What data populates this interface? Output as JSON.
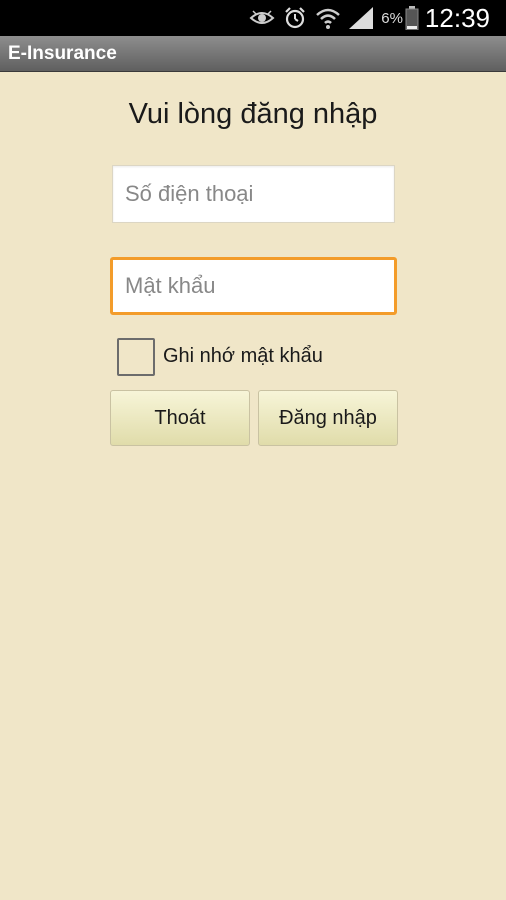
{
  "status_bar": {
    "battery_percent": "6%",
    "time": "12:39",
    "icons": [
      "eye-icon",
      "alarm-icon",
      "wifi-icon",
      "signal-icon",
      "battery-icon"
    ]
  },
  "app": {
    "title": "E-Insurance"
  },
  "login": {
    "heading": "Vui lòng đăng nhập",
    "phone_placeholder": "Số điện thoại",
    "phone_value": "",
    "password_placeholder": "Mật khẩu",
    "password_value": "",
    "remember_label": "Ghi nhớ mật khẩu",
    "remember_checked": false,
    "exit_label": "Thoát",
    "login_label": "Đăng nhập"
  },
  "colors": {
    "background": "#f0e6c8",
    "focus_border": "#f39c2a",
    "title_bar": "#6f6f6f"
  }
}
